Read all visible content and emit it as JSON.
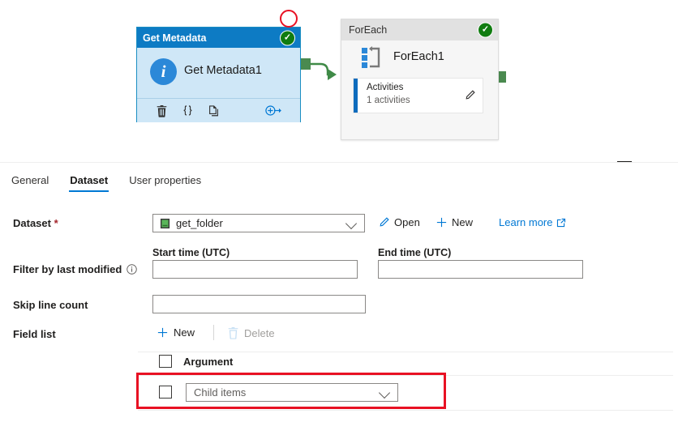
{
  "canvas": {
    "get_metadata_node": {
      "header_title": "Get Metadata",
      "status_icon": "check-circle-icon",
      "status_glyph": "✓",
      "activity_name": "Get Metadata1",
      "type_icon": "info-icon",
      "type_glyph": "i",
      "toolbar": [
        {
          "name": "delete-icon",
          "label": "Delete"
        },
        {
          "name": "code-braces-icon",
          "label": "{ }"
        },
        {
          "name": "clone-icon",
          "label": "Clone"
        },
        {
          "name": "add-output-icon",
          "label": "Add output"
        }
      ]
    },
    "foreach_node": {
      "header_title": "ForEach",
      "status_icon": "check-circle-icon",
      "status_glyph": "✓",
      "activity_name": "ForEach1",
      "activities_title": "Activities",
      "activities_count": "1 activities",
      "edit_icon": "pencil-icon"
    },
    "annotation_circle": {
      "name": "red-circle-annotation",
      "color": "#e81123"
    },
    "connector": {
      "color": "#4a8a4f"
    },
    "collapse_control": {
      "name": "collapse-panel-dash",
      "label": "—"
    }
  },
  "panel": {
    "tabs": [
      {
        "label": "General",
        "active": false
      },
      {
        "label": "Dataset",
        "active": true
      },
      {
        "label": "User properties",
        "active": false
      }
    ],
    "dataset": {
      "label": "Dataset",
      "required_mark": "*",
      "value": "get_folder",
      "icon": "dataset-icon",
      "caret_icon": "chevron-down-icon",
      "open_label": "Open",
      "open_icon": "pencil-icon",
      "new_label": "New",
      "new_icon": "plus-icon",
      "learn_more_label": "Learn more",
      "learn_more_icon": "external-link-icon"
    },
    "filter": {
      "label": "Filter by last modified",
      "info_icon": "info-circle-icon",
      "start_time_label": "Start time (UTC)",
      "start_time_value": "",
      "start_time_placeholder": "",
      "end_time_label": "End time (UTC)",
      "end_time_value": "",
      "end_time_placeholder": ""
    },
    "skip_line_count": {
      "label": "Skip line count",
      "value": "",
      "placeholder": ""
    },
    "field_list": {
      "label": "Field list",
      "new_label": "New",
      "new_icon": "plus-icon",
      "delete_label": "Delete",
      "delete_icon": "trash-icon",
      "delete_disabled": true,
      "header_row": {
        "checkbox_checked": false,
        "column_label": "Argument"
      },
      "rows": [
        {
          "checkbox_checked": false,
          "value": "Child items",
          "caret_icon": "chevron-down-icon",
          "highlighted": true
        }
      ]
    }
  },
  "colors": {
    "accent": "#0078d4",
    "node_header": "#0d7bc4",
    "node_body": "#cfe7f7",
    "success": "#107c10",
    "connector": "#4a8a4f",
    "annotation": "#e81123"
  }
}
